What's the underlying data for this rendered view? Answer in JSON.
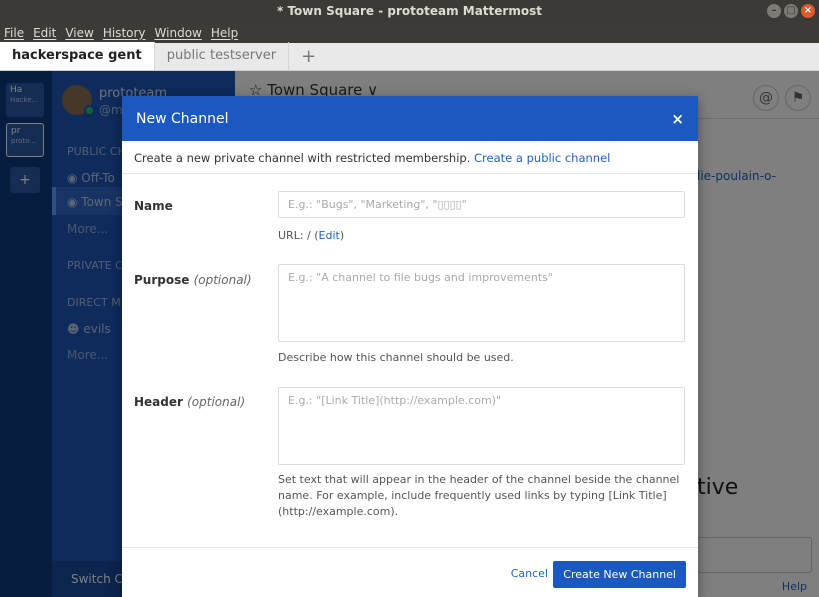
{
  "window": {
    "title": "* Town Square - prototeam Mattermost",
    "btn_min": "–",
    "btn_max": "□",
    "btn_close": "×"
  },
  "menu": [
    "File",
    "Edit",
    "View",
    "History",
    "Window",
    "Help"
  ],
  "server_tabs": {
    "tabs": [
      "hackerspace gent",
      "public testserver"
    ],
    "add": "+"
  },
  "team_sidebar": {
    "teams": [
      {
        "abbr": "Ha",
        "name": "Hacke..."
      },
      {
        "abbr": "pr",
        "name": "proto..."
      }
    ],
    "add": "+"
  },
  "channel_sidebar": {
    "team_name": "prototeam",
    "handle": "@m",
    "public_header": "PUBLIC CH",
    "channels": [
      "Off-To",
      "Town S"
    ],
    "more_public": "More...",
    "private_header": "PRIVATE C",
    "direct_header": "DIRECT M",
    "dm_user": "evils",
    "more_direct": "More...",
    "switch": "Switch Ch"
  },
  "center": {
    "channel_title": "☆ Town Square ∨",
    "at_icon": "@",
    "flag_icon": "⚑",
    "bg_link": "lie-poulain-o-",
    "bg_big": "tive",
    "help": "Help"
  },
  "modal": {
    "title": "New Channel",
    "close": "×",
    "intro_text": "Create a new private channel with restricted membership.",
    "intro_link": "Create a public channel",
    "name_label": "Name",
    "name_placeholder": "E.g.: \"Bugs\", \"Marketing\", \"▯▯▯▯\"",
    "url_text": "URL: / (",
    "url_edit": "Edit",
    "url_close": ")",
    "purpose_label": "Purpose",
    "purpose_optional": "(optional)",
    "purpose_placeholder": "E.g.: \"A channel to file bugs and improvements\"",
    "purpose_help": "Describe how this channel should be used.",
    "header_label": "Header",
    "header_optional": "(optional)",
    "header_placeholder": "E.g.: \"[Link Title](http://example.com)\"",
    "header_help": "Set text that will appear in the header of the channel beside the channel name. For example, include frequently used links by typing [Link Title] (http://example.com).",
    "cancel": "Cancel",
    "create": "Create New Channel"
  }
}
